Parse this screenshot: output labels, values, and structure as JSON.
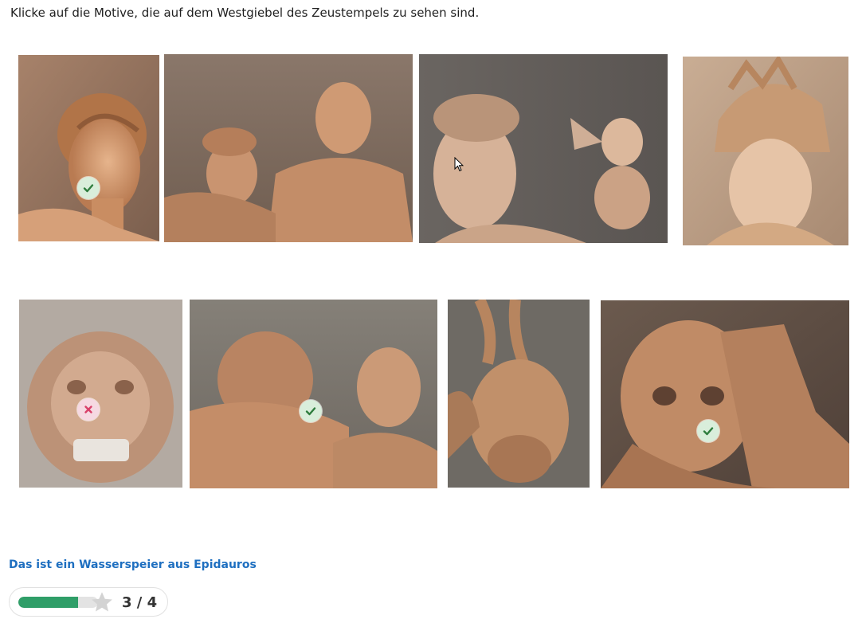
{
  "instruction": "Klicke auf die Motive, die auf dem Westgiebel des Zeustempels zu sehen sind.",
  "tiles": [
    {
      "id": "apollo-head",
      "mark": "check-icon",
      "state": "correct"
    },
    {
      "id": "lapith-group",
      "mark": null,
      "state": "unselected"
    },
    {
      "id": "aphrodite-eros",
      "mark": null,
      "state": "unselected"
    },
    {
      "id": "athena-helmet",
      "mark": null,
      "state": "unselected"
    },
    {
      "id": "lion-head",
      "mark": "cross-icon",
      "state": "incorrect"
    },
    {
      "id": "centaur-lapith",
      "mark": "check-icon",
      "state": "correct"
    },
    {
      "id": "satyr-head",
      "mark": null,
      "state": "unselected"
    },
    {
      "id": "old-woman",
      "mark": "check-icon",
      "state": "correct"
    }
  ],
  "feedback": "Das ist ein Wasserspeier aus Epidauros",
  "progress": {
    "score_text": "3 / 4",
    "correct": 3,
    "total": 4,
    "fraction": 0.75,
    "icon": "star-icon"
  },
  "colors": {
    "correct": "#2f7d3e",
    "incorrect": "#d94069",
    "link": "#1e6fc0",
    "progress": "#2f9e68"
  }
}
